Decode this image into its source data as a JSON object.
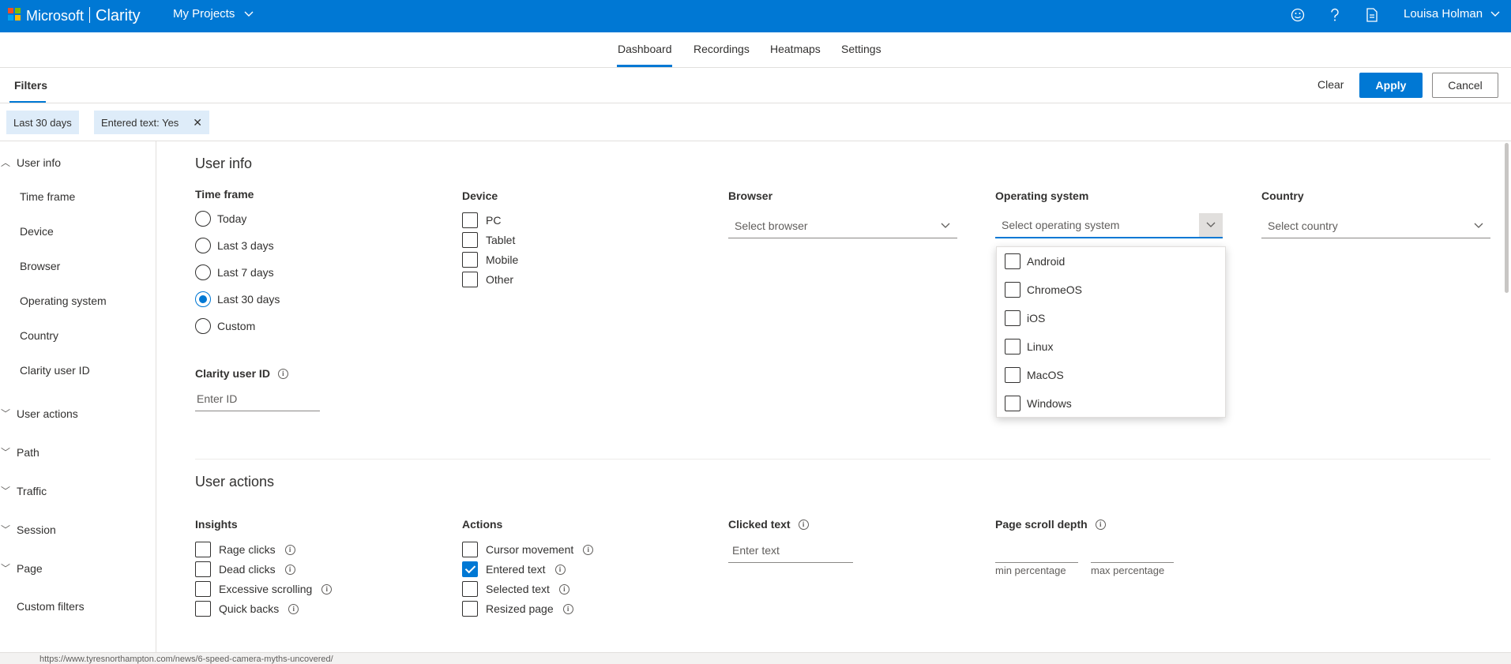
{
  "topbar": {
    "brand": "Microsoft",
    "product": "Clarity",
    "projects_label": "My Projects",
    "user_name": "Louisa Holman"
  },
  "nav": {
    "tabs": [
      {
        "label": "Dashboard",
        "active": true
      },
      {
        "label": "Recordings",
        "active": false
      },
      {
        "label": "Heatmaps",
        "active": false
      },
      {
        "label": "Settings",
        "active": false
      }
    ]
  },
  "filters": {
    "title": "Filters",
    "clear_label": "Clear",
    "apply_label": "Apply",
    "cancel_label": "Cancel"
  },
  "chips": [
    {
      "label": "Last 30 days",
      "removable": false
    },
    {
      "label": "Entered text: Yes",
      "removable": true
    }
  ],
  "sidebar": {
    "user_info": "User info",
    "user_info_items": [
      "Time frame",
      "Device",
      "Browser",
      "Operating system",
      "Country",
      "Clarity user ID"
    ],
    "user_actions": "User actions",
    "path": "Path",
    "traffic": "Traffic",
    "session": "Session",
    "page": "Page",
    "custom_filters": "Custom filters"
  },
  "user_info": {
    "title": "User info",
    "time_frame": {
      "title": "Time frame",
      "options": [
        "Today",
        "Last 3 days",
        "Last 7 days",
        "Last 30 days",
        "Custom"
      ],
      "selected": "Last 30 days"
    },
    "device": {
      "title": "Device",
      "options": [
        "PC",
        "Tablet",
        "Mobile",
        "Other"
      ]
    },
    "browser": {
      "title": "Browser",
      "placeholder": "Select browser"
    },
    "os": {
      "title": "Operating system",
      "placeholder": "Select operating system",
      "options": [
        "Android",
        "ChromeOS",
        "iOS",
        "Linux",
        "MacOS",
        "Windows"
      ]
    },
    "country": {
      "title": "Country",
      "placeholder": "Select country"
    },
    "clarity_user_id": {
      "title": "Clarity user ID",
      "placeholder": "Enter ID"
    }
  },
  "user_actions": {
    "title": "User actions",
    "insights": {
      "title": "Insights",
      "options": [
        "Rage clicks",
        "Dead clicks",
        "Excessive scrolling",
        "Quick backs"
      ]
    },
    "actions": {
      "title": "Actions",
      "options": [
        "Cursor movement",
        "Entered text",
        "Selected text",
        "Resized page"
      ],
      "checked": "Entered text"
    },
    "clicked_text": {
      "title": "Clicked text",
      "placeholder": "Enter text"
    },
    "scroll_depth": {
      "title": "Page scroll depth",
      "min_label": "min percentage",
      "max_label": "max percentage"
    }
  },
  "bottom_url": "https://www.tyresnorthampton.com/news/6-speed-camera-myths-uncovered/"
}
